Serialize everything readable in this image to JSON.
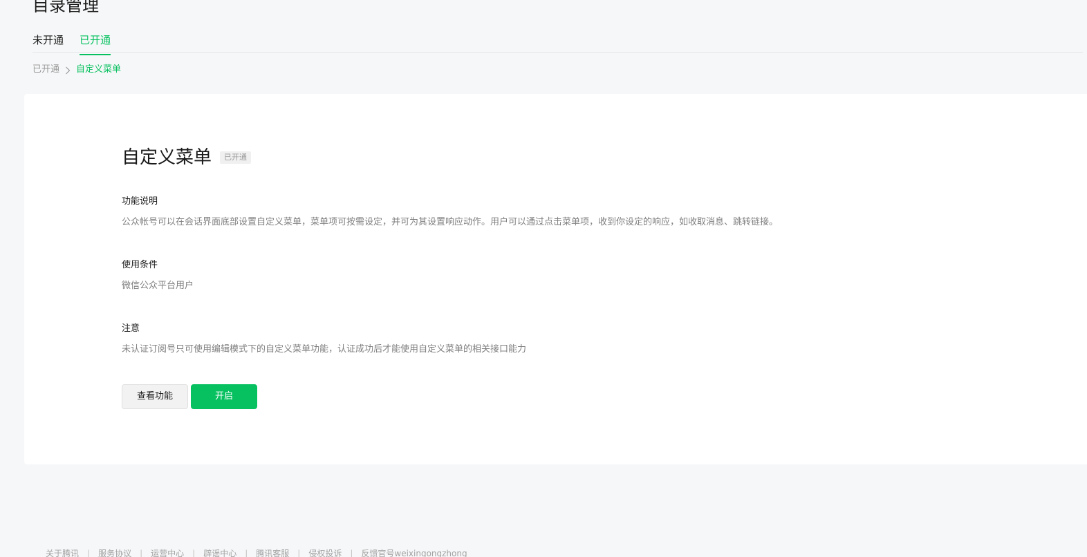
{
  "header": {
    "title": "目录管理"
  },
  "tabs": [
    {
      "label": "未开通",
      "active": false
    },
    {
      "label": "已开通",
      "active": true
    }
  ],
  "breadcrumb": {
    "parent": "已开通",
    "separator_icon": "chevron-right-icon",
    "current": "自定义菜单"
  },
  "feature": {
    "title": "自定义菜单",
    "status": "已开通",
    "sections": [
      {
        "label": "功能说明",
        "text": "公众帐号可以在会话界面底部设置自定义菜单，菜单项可按需设定，并可为其设置响应动作。用户可以通过点击菜单项，收到你设定的响应，如收取消息、跳转链接。"
      },
      {
        "label": "使用条件",
        "text": "微信公众平台用户"
      },
      {
        "label": "注意",
        "text": "未认证订阅号只可使用编辑模式下的自定义菜单功能，认证成功后才能使用自定义菜单的相关接口能力"
      }
    ],
    "buttons": {
      "view_label": "查看功能",
      "enable_label": "开启"
    }
  },
  "footer": {
    "links": [
      "关于腾讯",
      "服务协议",
      "运营中心",
      "辟谣中心",
      "腾讯客服",
      "侵权投诉",
      "反馈官号weixingongzhong"
    ]
  },
  "colors": {
    "accent": "#07c160",
    "background": "#f6f7f8",
    "card": "#ffffff"
  }
}
